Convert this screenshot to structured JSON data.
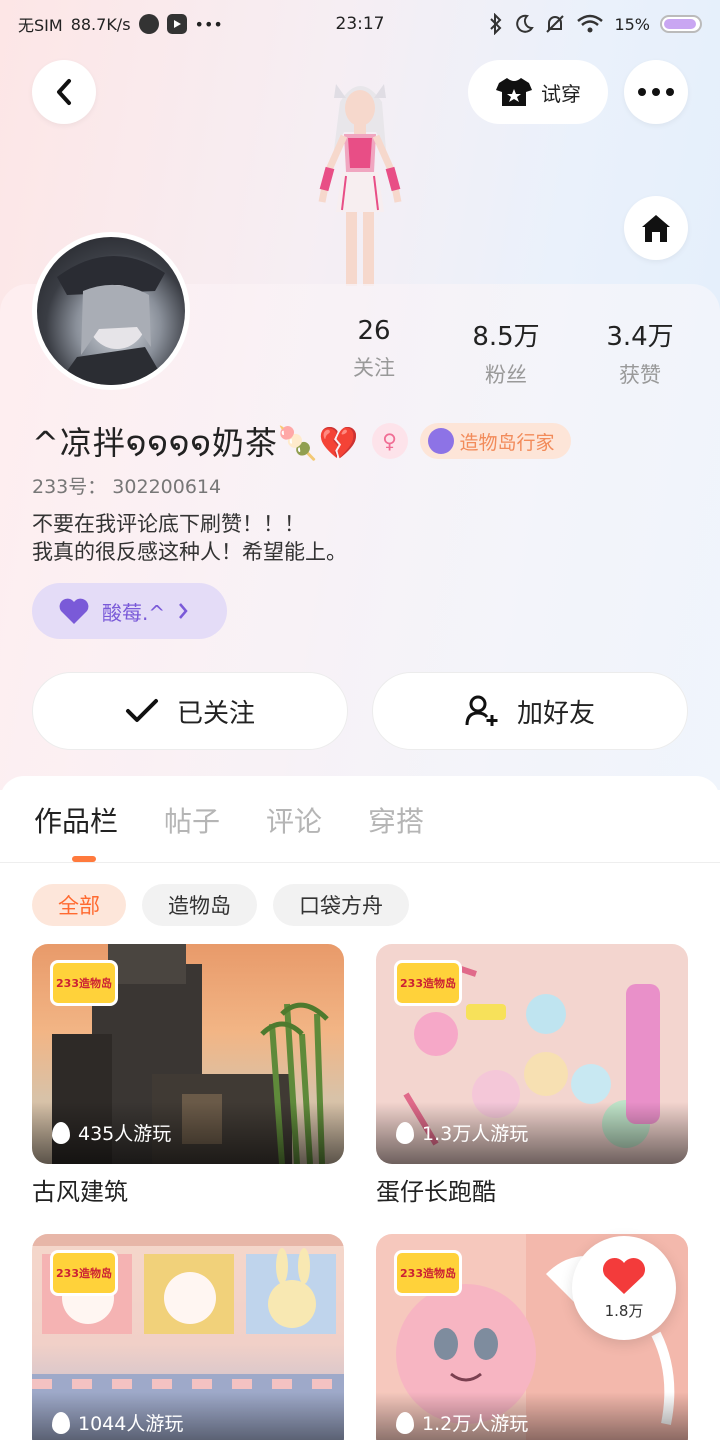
{
  "status_bar": {
    "carrier": "无SIM",
    "speed": "88.7K/s",
    "time": "23:17",
    "battery": "15%",
    "battery_level": 0.15
  },
  "header": {
    "tryon_label": "试穿",
    "back_icon": "chevron-left-icon",
    "more_icon": "more-dots-icon",
    "home_icon": "home-icon"
  },
  "profile": {
    "nickname": "^凉拌໑໑໑໑奶茶🍡💔",
    "gender_symbol": "♀",
    "tag": "造物岛行家",
    "uid": "233号： 302200614",
    "bio_line1": "不要在我评论底下刷赞！！！",
    "bio_line2": "我真的很反感这种人！希望能上。",
    "relation_label": "酸莓.^",
    "stats": [
      {
        "value": "26",
        "label": "关注"
      },
      {
        "value": "8.5万",
        "label": "粉丝"
      },
      {
        "value": "3.4万",
        "label": "获赞"
      }
    ]
  },
  "actions": {
    "followed_label": "已关注",
    "add_friend_label": "加好友"
  },
  "tabs": [
    "作品栏",
    "帖子",
    "评论",
    "穿搭"
  ],
  "filters": [
    "全部",
    "造物岛",
    "口袋方舟"
  ],
  "cards": [
    {
      "title": "古风建筑",
      "plays": "435人游玩",
      "logo": "233造物岛"
    },
    {
      "title": "蛋仔长跑酷",
      "plays": "1.3万人游玩",
      "logo": "233造物岛"
    },
    {
      "title": "",
      "plays": "1044人游玩",
      "logo": "233造物岛"
    },
    {
      "title": "",
      "plays": "1.2万人游玩",
      "logo": "233造物岛"
    }
  ],
  "like_float": {
    "count": "1.8万"
  },
  "colors": {
    "accent": "#ff7a3d",
    "purple": "#7a5ad8",
    "pink": "#f06d94"
  }
}
